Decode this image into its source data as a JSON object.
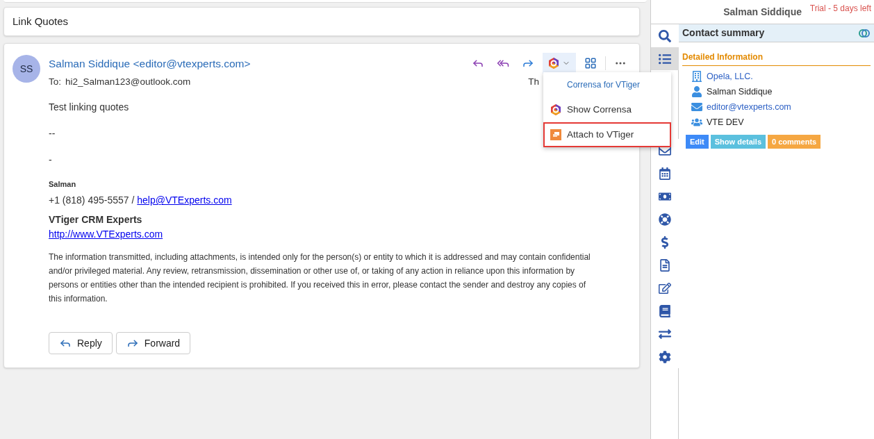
{
  "section_title": "Link Quotes",
  "email": {
    "avatar": "SS",
    "from": "Salman Siddique <editor@vtexperts.com>",
    "to_label": "To:",
    "to": "hi2_Salman123@outlook.com",
    "date": "Th",
    "body": [
      {
        "kind": "text",
        "text": "Test linking quotes"
      },
      {
        "kind": "text",
        "text": "--"
      },
      {
        "kind": "text",
        "text": "-"
      },
      {
        "kind": "small-bold",
        "text": "Salman"
      },
      {
        "kind": "phone",
        "text": "+1 (818) 495-5557 / ",
        "link": "help@VTExperts.com"
      },
      {
        "kind": "company",
        "text": "VTiger CRM Experts",
        "link": "http://www.VTExperts.com"
      },
      {
        "kind": "disclaimer",
        "text": "The information transmitted, including attachments, is intended only for the person(s) or entity to which it is addressed and may contain confidential and/or privileged material. Any review, retransmission, dissemination or other use of, or taking of any action in reliance upon this information by persons or entities other than the intended recipient is prohibited. If you received this in error, please contact the sender and destroy any copies of this information."
      }
    ],
    "buttons": [
      {
        "kind": "reply",
        "label": "Reply"
      },
      {
        "kind": "forward",
        "label": "Forward"
      }
    ]
  },
  "menu": {
    "title": "Corrensa for VTiger",
    "items": [
      {
        "kind": "corrensa",
        "label": "Show Corrensa",
        "selected": false
      },
      {
        "kind": "attach",
        "label": "Attach to VTiger",
        "selected": true
      }
    ]
  },
  "panel": {
    "header_name": "Salman Siddique",
    "trial": "Trial - 5 days left",
    "title": "Contact summary",
    "section": "Detailed Information",
    "fields": [
      {
        "kind": "company",
        "text": "Opela, LLC."
      },
      {
        "kind": "person",
        "text": "Salman Siddique"
      },
      {
        "kind": "email",
        "text": "editor@vtexperts.com"
      },
      {
        "kind": "group",
        "text": "VTE DEV"
      }
    ],
    "actions": [
      {
        "label": "Edit",
        "color": "#3d8af7"
      },
      {
        "label": "Show details",
        "color": "#5bc0de"
      },
      {
        "label": "0 comments",
        "color": "#f5a742"
      }
    ]
  },
  "sidebar": {
    "items": [
      {
        "kind": "search",
        "selected": false
      },
      {
        "kind": "list",
        "selected": true
      },
      {
        "kind": "gap"
      },
      {
        "kind": "gap"
      },
      {
        "kind": "gap"
      },
      {
        "kind": "envelope",
        "selected": false
      },
      {
        "kind": "calendar",
        "selected": false
      },
      {
        "kind": "money",
        "selected": false
      },
      {
        "kind": "lifering",
        "selected": false
      },
      {
        "kind": "dollar",
        "selected": false
      },
      {
        "kind": "file",
        "selected": false
      },
      {
        "kind": "edit",
        "selected": false
      },
      {
        "kind": "book",
        "selected": false
      },
      {
        "kind": "exchange",
        "selected": false
      },
      {
        "kind": "cog",
        "selected": false
      }
    ]
  }
}
